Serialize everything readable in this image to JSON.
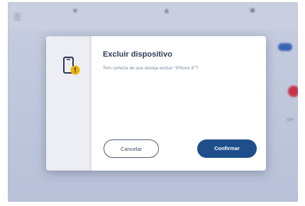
{
  "dialog": {
    "title": "Excluir dispositivo",
    "message": "Tem certeza de que deseja excluir \"iPhone 8\"?",
    "cancel_label": "Cancelar",
    "confirm_label": "Confirmar",
    "icon": "phone-warning-icon"
  },
  "colors": {
    "accent": "#1f4e8c",
    "warning": "#f0b400",
    "overlay": "#b2bccf"
  }
}
